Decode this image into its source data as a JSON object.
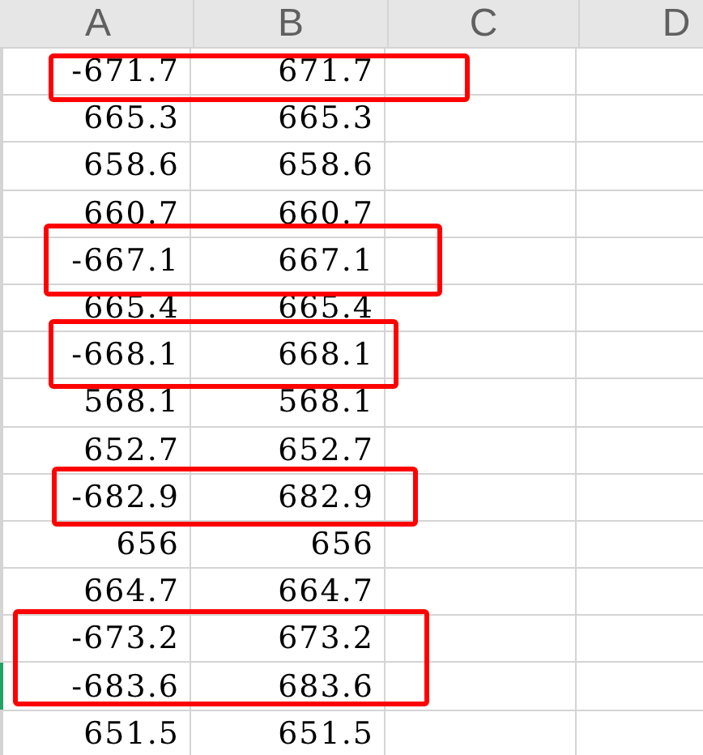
{
  "columns": [
    "A",
    "B",
    "C",
    "D"
  ],
  "rows": [
    {
      "cells": [
        "-671.7",
        "671.7"
      ],
      "active": false,
      "highlighted": true
    },
    {
      "cells": [
        "665.3",
        "665.3"
      ],
      "active": false,
      "highlighted": false
    },
    {
      "cells": [
        "658.6",
        "658.6"
      ],
      "active": false,
      "highlighted": false
    },
    {
      "cells": [
        "660.7",
        "660.7"
      ],
      "active": false,
      "highlighted": false
    },
    {
      "cells": [
        "-667.1",
        "667.1"
      ],
      "active": false,
      "highlighted": true
    },
    {
      "cells": [
        "665.4",
        "665.4"
      ],
      "active": false,
      "highlighted": false
    },
    {
      "cells": [
        "-668.1",
        "668.1"
      ],
      "active": false,
      "highlighted": true
    },
    {
      "cells": [
        "568.1",
        "568.1"
      ],
      "active": false,
      "highlighted": false
    },
    {
      "cells": [
        "652.7",
        "652.7"
      ],
      "active": false,
      "highlighted": false
    },
    {
      "cells": [
        "-682.9",
        "682.9"
      ],
      "active": false,
      "highlighted": true
    },
    {
      "cells": [
        "656",
        "656"
      ],
      "active": false,
      "highlighted": false
    },
    {
      "cells": [
        "664.7",
        "664.7"
      ],
      "active": false,
      "highlighted": false
    },
    {
      "cells": [
        "-673.2",
        "673.2"
      ],
      "active": false,
      "highlighted": true
    },
    {
      "cells": [
        "-683.6",
        "683.6"
      ],
      "active": true,
      "highlighted": true
    },
    {
      "cells": [
        "651.5",
        "651.5"
      ],
      "active": false,
      "highlighted": false
    }
  ]
}
